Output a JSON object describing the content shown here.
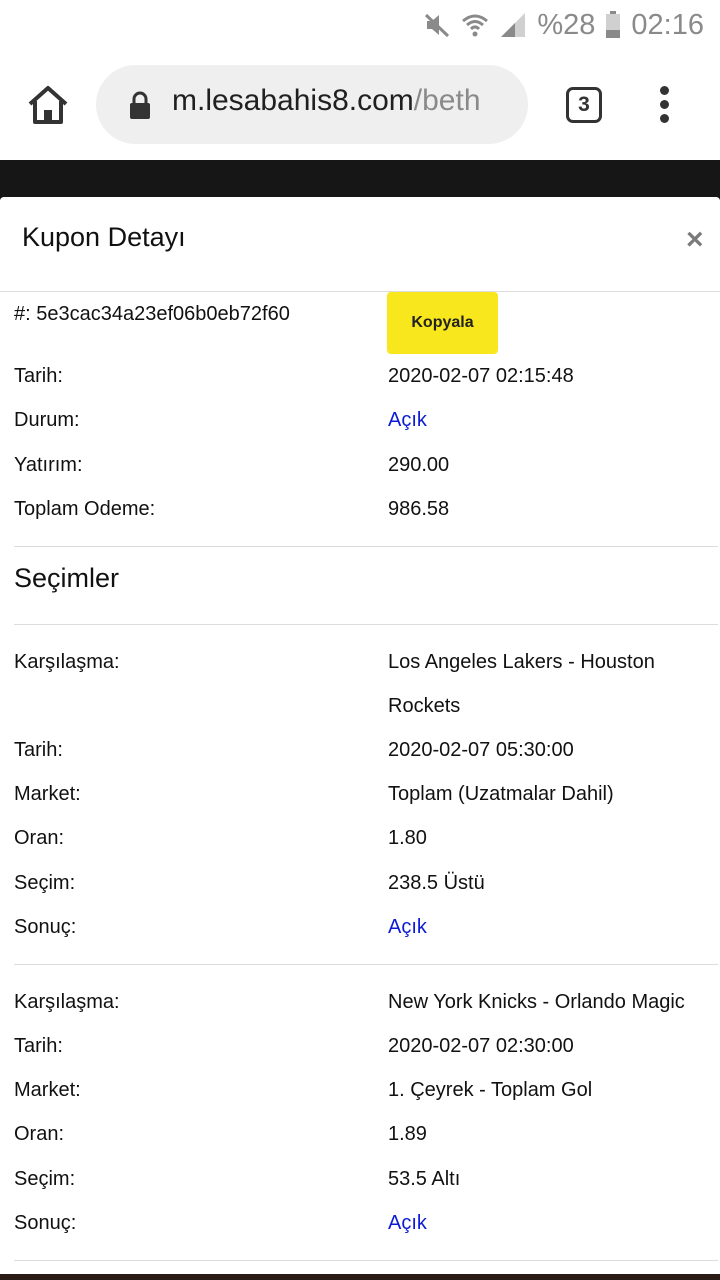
{
  "status_bar": {
    "battery": "%28",
    "time": "02:16"
  },
  "browser": {
    "url_host": "m.lesabahis8.com",
    "url_path": "/beth",
    "tab_count": "3"
  },
  "modal": {
    "title": "Kupon Detayı",
    "close": "×",
    "coupon_id": "#: 5e3cac34a23ef06b0eb72f60",
    "copy_label": "Kopyala",
    "summary": [
      {
        "label": "Tarih:",
        "value": "2020-02-07 02:15:48"
      },
      {
        "label": "Durum:",
        "value": "Açık"
      },
      {
        "label": "Yatırım:",
        "value": "290.00"
      },
      {
        "label": "Toplam Odeme:",
        "value": "986.58"
      }
    ],
    "selections_title": "Seçimler",
    "selections": [
      {
        "match_label": "Karşılaşma:",
        "match": "Los Angeles Lakers - Houston Rockets",
        "date_label": "Tarih:",
        "date": "2020-02-07 05:30:00",
        "market_label": "Market:",
        "market": "Toplam (Uzatmalar Dahil)",
        "odds_label": "Oran:",
        "odds": "1.80",
        "pick_label": "Seçim:",
        "pick": "238.5 Üstü",
        "result_label": "Sonuç:",
        "result": "Açık"
      },
      {
        "match_label": "Karşılaşma:",
        "match": "New York Knicks - Orlando Magic",
        "date_label": "Tarih:",
        "date": "2020-02-07 02:30:00",
        "market_label": "Market:",
        "market": "1. Çeyrek - Toplam Gol",
        "odds_label": "Oran:",
        "odds": "1.89",
        "pick_label": "Seçim:",
        "pick": "53.5 Altı",
        "result_label": "Sonuç:",
        "result": "Açık"
      }
    ]
  },
  "colors": {
    "accent_yellow": "#f7e71c",
    "link_blue": "#0b1bd6"
  }
}
